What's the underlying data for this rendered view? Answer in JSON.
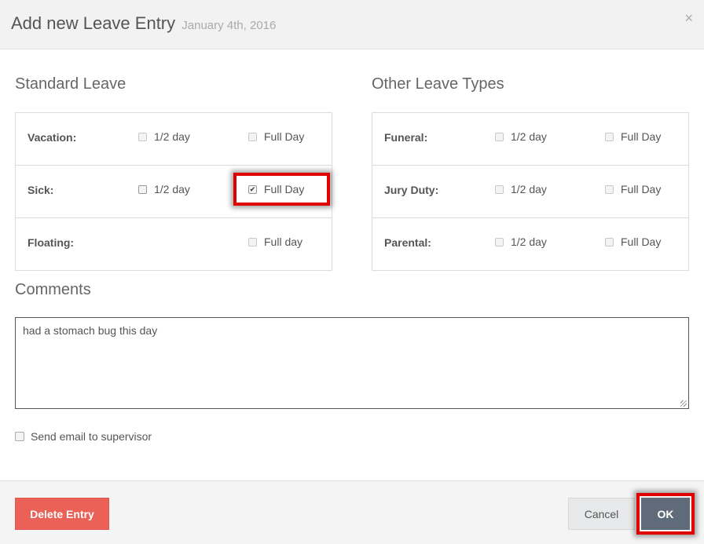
{
  "header": {
    "title": "Add new Leave Entry",
    "date": "January 4th, 2016",
    "close_icon": "×"
  },
  "standard_leave": {
    "title": "Standard Leave",
    "rows": [
      {
        "label": "Vacation:",
        "half_label": "1/2 day",
        "half_checked": false,
        "full_label": "Full Day",
        "full_checked": false
      },
      {
        "label": "Sick:",
        "half_label": "1/2 day",
        "half_checked": false,
        "full_label": "Full Day",
        "full_checked": true
      },
      {
        "label": "Floating:",
        "full_label": "Full day",
        "full_checked": false
      }
    ]
  },
  "other_leave": {
    "title": "Other Leave Types",
    "rows": [
      {
        "label": "Funeral:",
        "half_label": "1/2 day",
        "half_checked": false,
        "full_label": "Full Day",
        "full_checked": false
      },
      {
        "label": "Jury Duty:",
        "half_label": "1/2 day",
        "half_checked": false,
        "full_label": "Full Day",
        "full_checked": false
      },
      {
        "label": "Parental:",
        "half_label": "1/2 day",
        "half_checked": false,
        "full_label": "Full Day",
        "full_checked": false
      }
    ]
  },
  "comments": {
    "title": "Comments",
    "value": "had a stomach bug this day"
  },
  "email": {
    "label": "Send email to supervisor",
    "checked": false
  },
  "footer": {
    "delete_label": "Delete Entry",
    "cancel_label": "Cancel",
    "ok_label": "OK"
  },
  "colors": {
    "delete": "#eb6157",
    "ok": "#5f6b78",
    "highlight": "#e00000"
  }
}
